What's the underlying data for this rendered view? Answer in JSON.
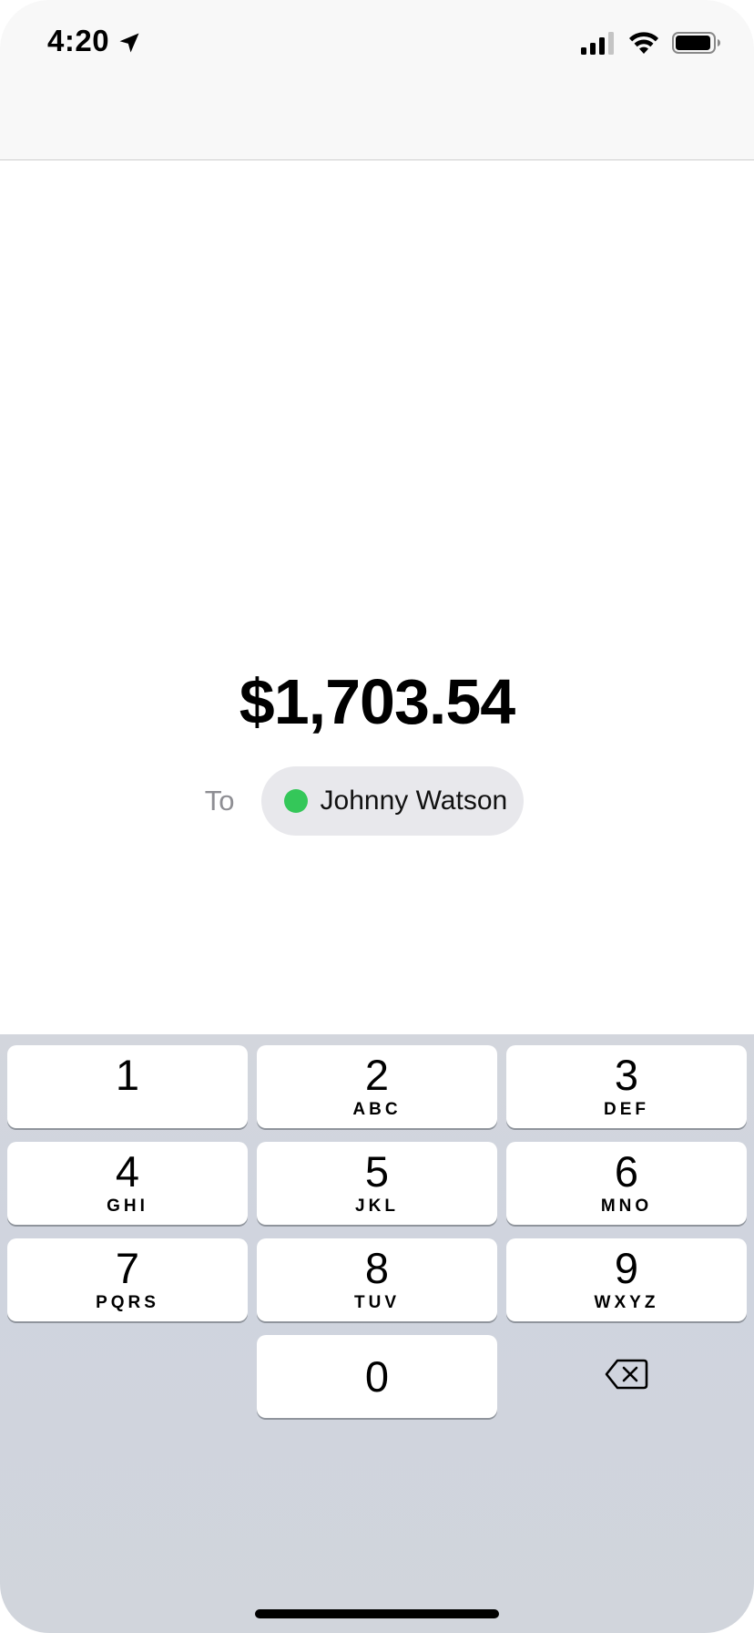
{
  "status_bar": {
    "time": "4:20",
    "icons": [
      "location-arrow-icon",
      "cellular-signal-icon",
      "wifi-icon",
      "battery-icon"
    ]
  },
  "payment": {
    "amount": "$1,703.54",
    "to_label": "To",
    "recipient_name": "Johnny Watson",
    "recipient_status_color": "#34c759"
  },
  "keypad": {
    "keys": [
      {
        "digit": "1",
        "letters": ""
      },
      {
        "digit": "2",
        "letters": "ABC"
      },
      {
        "digit": "3",
        "letters": "DEF"
      },
      {
        "digit": "4",
        "letters": "GHI"
      },
      {
        "digit": "5",
        "letters": "JKL"
      },
      {
        "digit": "6",
        "letters": "MNO"
      },
      {
        "digit": "7",
        "letters": "PQRS"
      },
      {
        "digit": "8",
        "letters": "TUV"
      },
      {
        "digit": "9",
        "letters": "WXYZ"
      },
      {
        "digit": "0",
        "letters": ""
      }
    ],
    "delete_icon": "delete-backspace-icon"
  }
}
